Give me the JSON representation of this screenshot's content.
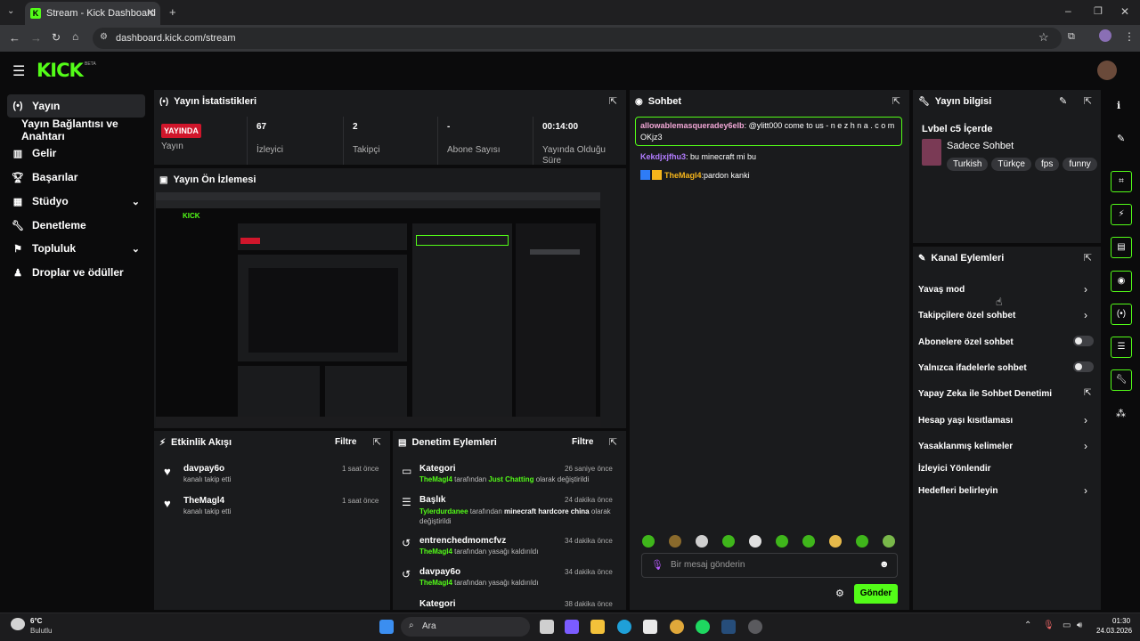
{
  "browser": {
    "tab_title": "Stream - Kick Dashboard",
    "url": "dashboard.kick.com/stream"
  },
  "header": {
    "logo": "KICK",
    "beta": "BETA"
  },
  "sidebar": {
    "items": [
      {
        "label": "Yayın",
        "icon": "broadcast-icon"
      },
      {
        "label": "Yayın Bağlantısı ve Anahtarı"
      },
      {
        "label": "Gelir",
        "icon": "chart-icon"
      },
      {
        "label": "Başarılar",
        "icon": "trophy-icon"
      },
      {
        "label": "Stüdyo",
        "icon": "studio-icon"
      },
      {
        "label": "Denetleme",
        "icon": "wrench-icon"
      },
      {
        "label": "Topluluk",
        "icon": "community-icon"
      },
      {
        "label": "Droplar ve ödüller",
        "icon": "drops-icon"
      }
    ]
  },
  "stats": {
    "title": "Yayın İstatistikleri",
    "live": "YAYINDA",
    "live_label": "Yayın",
    "viewers": "67",
    "viewers_label": "İzleyici",
    "followers": "2",
    "followers_label": "Takipçi",
    "subs": "-",
    "subs_label": "Abone Sayısı",
    "duration": "00:14:00",
    "duration_label": "Yayında Olduğu Süre"
  },
  "preview": {
    "title": "Yayın Ön İzlemesi"
  },
  "activity": {
    "title": "Etkinlik Akışı",
    "filter": "Filtre",
    "items": [
      {
        "name": "davpay6o",
        "text": "kanalı takip etti",
        "time": "1 saat önce"
      },
      {
        "name": "TheMagl4",
        "text": "kanalı takip etti",
        "time": "1 saat önce"
      }
    ]
  },
  "moderation": {
    "title": "Denetim Eylemleri",
    "filter": "Filtre",
    "items": [
      {
        "title": "Kategori",
        "time": "26 saniye önce",
        "actor": "TheMagl4",
        "mid": "tarafından",
        "target": "Just Chatting",
        "end": "olarak değiştirildi"
      },
      {
        "title": "Başlık",
        "time": "24 dakika önce",
        "actor": "Tylerdurdanee",
        "mid": "tarafından",
        "target": "minecraft hardcore china",
        "end": "olarak değiştirildi"
      },
      {
        "title": "entrenchedmomcfvz",
        "time": "34 dakika önce",
        "actor": "TheMagl4",
        "mid": "tarafından yasağı kaldırıldı"
      },
      {
        "title": "davpay6o",
        "time": "34 dakika önce",
        "actor": "TheMagl4",
        "mid": "tarafından yasağı kaldırıldı"
      },
      {
        "title": "Kategori",
        "time": "38 dakika önce"
      }
    ]
  },
  "chat": {
    "title": "Sohbet",
    "messages": [
      {
        "user": "allowablemasqueradey6elb",
        "text": "@ylitt000 come to us - n e z h n a . c o m OKjz3",
        "color": "#f2a7d6"
      },
      {
        "user": "Kekdjxjfhu3",
        "text": "bu minecraft mi bu",
        "color": "#b27cff"
      },
      {
        "user": "TheMagl4",
        "text": "pardon kanki",
        "color": "#f5b51b"
      }
    ],
    "placeholder": "Bir mesaj gönderin",
    "send": "Gönder"
  },
  "info": {
    "title": "Yayın bilgisi",
    "stream_title": "Lvbel c5 İçerde",
    "category": "Sadece Sohbet",
    "tags": [
      "Turkish",
      "Türkçe",
      "fps",
      "funny"
    ]
  },
  "actions": {
    "title": "Kanal Eylemleri",
    "items": [
      "Yavaş mod",
      "Takipçilere özel sohbet",
      "Abonelere özel sohbet",
      "Yalnızca ifadelerle sohbet",
      "Yapay Zeka ile Sohbet Denetimi",
      "Hesap yaşı kısıtlaması",
      "Yasaklanmış kelimeler",
      "İzleyici Yönlendir",
      "Hedefleri belirleyin"
    ]
  },
  "taskbar": {
    "temp": "6°C",
    "weather": "Bulutlu",
    "search": "Ara",
    "time": "01:30",
    "date": "24.03.2026"
  },
  "colors": {
    "accent": "#53fc18",
    "live": "#d0162b"
  }
}
